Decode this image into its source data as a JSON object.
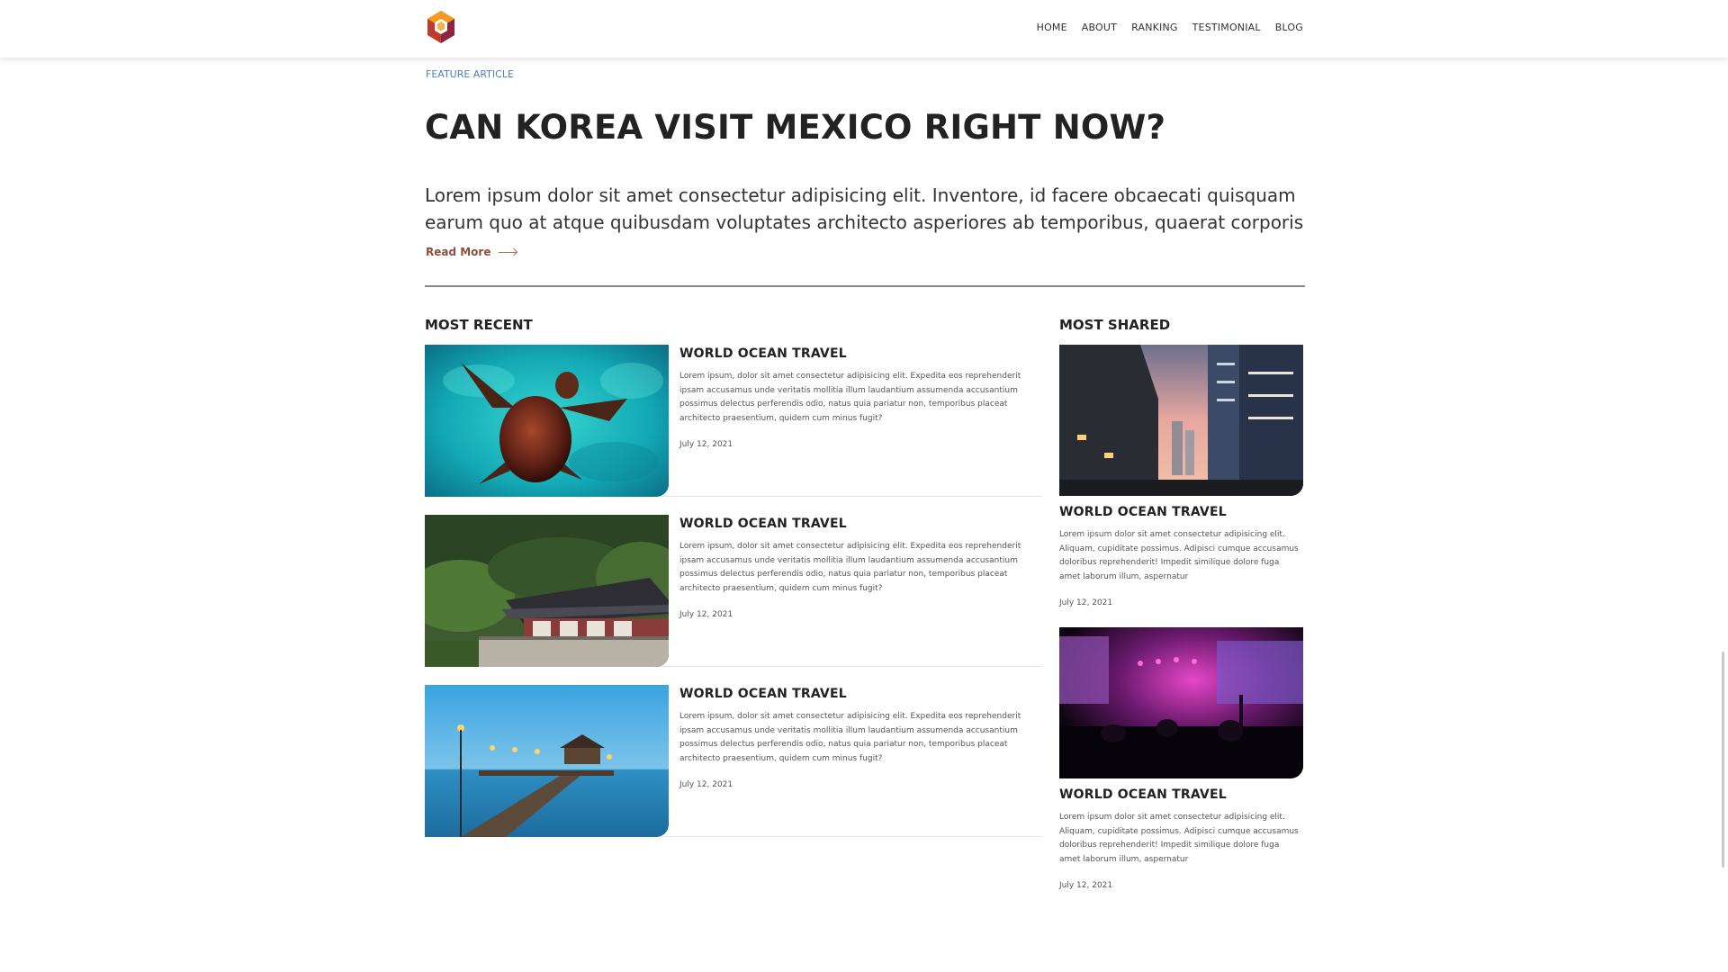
{
  "nav": {
    "items": [
      "HOME",
      "ABOUT",
      "RANKING",
      "TESTIMONIAL",
      "BLOG"
    ]
  },
  "feature": {
    "label": "FEATURE ARTICLE",
    "title": "CAN KOREA VISIT MEXICO RIGHT NOW?",
    "text": "Lorem ipsum dolor sit amet consectetur adipisicing elit. Inventore, id facere obcaecati quisquam earum quo at atque quibusdam voluptates architecto asperiores ab temporibus, quaerat corporis",
    "read_more": "Read More"
  },
  "most_recent": {
    "title": "MOST RECENT",
    "items": [
      {
        "title": "WORLD OCEAN TRAVEL",
        "body": "Lorem ipsum, dolor sit amet consectetur adipisicing elit. Expedita eos reprehenderit ipsam accusamus unde veritatis mollitia illum laudantium assumenda accusantium possimus delectus perferendis odio, natus quia pariatur non, temporibus placeat architecto praesentium, quidem cum minus fugit?",
        "date": "July 12, 2021",
        "image": "sea-turtle-photo"
      },
      {
        "title": "WORLD OCEAN TRAVEL",
        "body": "Lorem ipsum, dolor sit amet consectetur adipisicing elit. Expedita eos reprehenderit ipsam accusamus unde veritatis mollitia illum laudantium assumenda accusantium possimus delectus perferendis odio, natus quia pariatur non, temporibus placeat architecto praesentium, quidem cum minus fugit?",
        "date": "July 12, 2021",
        "image": "korean-house-photo"
      },
      {
        "title": "WORLD OCEAN TRAVEL",
        "body": "Lorem ipsum, dolor sit amet consectetur adipisicing elit. Expedita eos reprehenderit ipsam accusamus unde veritatis mollitia illum laudantium assumenda accusantium possimus delectus perferendis odio, natus quia pariatur non, temporibus placeat architecto praesentium, quidem cum minus fugit?",
        "date": "July 12, 2021",
        "image": "pier-photo"
      }
    ]
  },
  "most_shared": {
    "title": "MOST SHARED",
    "items": [
      {
        "title": "WORLD OCEAN TRAVEL",
        "body": "Lorem ipsum dolor sit amet consectetur adipisicing elit. Aliquam, cupiditate possimus. Adipisci cumque accusamus doloribus reprehenderit! Impedit similique dolore fuga amet laborum illum, aspernatur",
        "date": "July 12, 2021",
        "image": "city-street-photo"
      },
      {
        "title": "WORLD OCEAN TRAVEL",
        "body": "Lorem ipsum dolor sit amet consectetur adipisicing elit. Aliquam, cupiditate possimus. Adipisci cumque accusamus doloribus reprehenderit! Impedit similique dolore fuga amet laborum illum, aspernatur",
        "date": "July 12, 2021",
        "image": "concert-photo"
      }
    ]
  },
  "colors": {
    "accent_blue": "#4f7fb4",
    "read_more": "#8a4f3f",
    "logo_orange": "#f39a21",
    "logo_red": "#c0392b"
  }
}
